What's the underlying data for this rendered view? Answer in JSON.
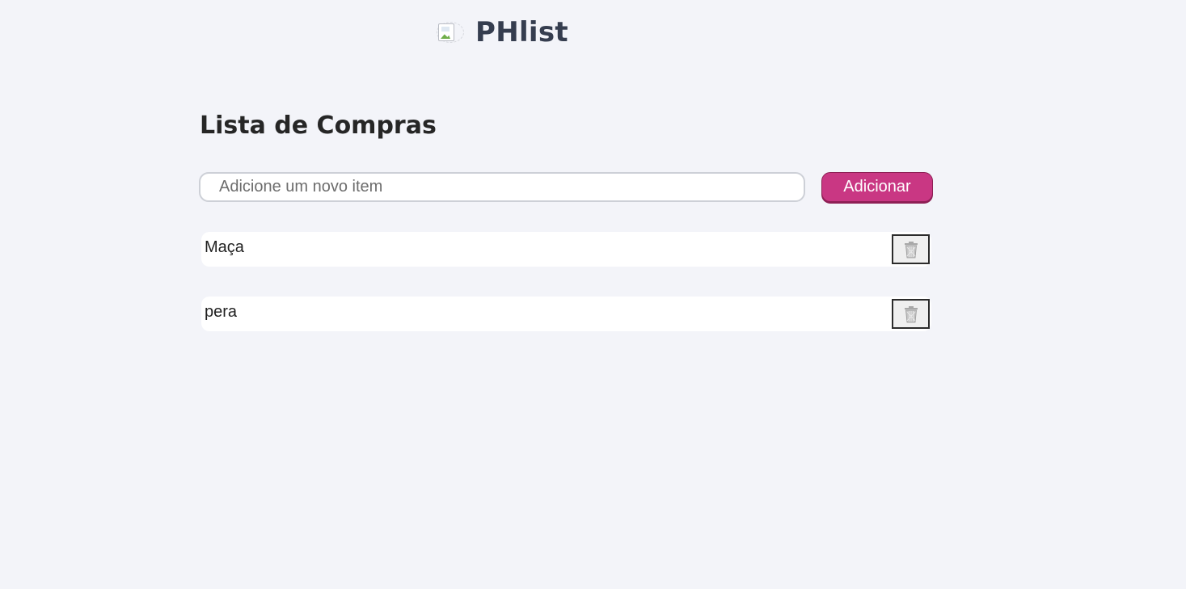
{
  "header": {
    "logo_icon": "broken-image-icon",
    "brand": "PHlist"
  },
  "main": {
    "title": "Lista de Compras",
    "input": {
      "value": "",
      "placeholder": "Adicione um novo item"
    },
    "add_button_label": "Adicionar",
    "items": [
      {
        "label": "Maça",
        "delete_icon": "trash-icon"
      },
      {
        "label": "pera",
        "delete_icon": "trash-icon"
      }
    ]
  },
  "colors": {
    "background": "#f3f4f9",
    "accent": "#c93783",
    "brand_text": "#353d4f"
  }
}
